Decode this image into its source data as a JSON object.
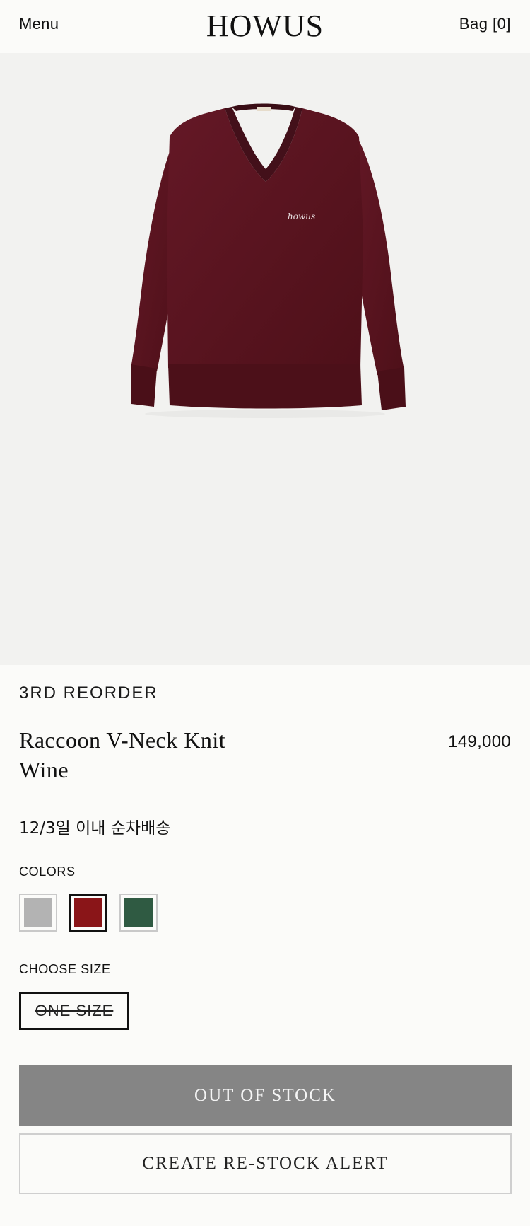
{
  "header": {
    "menu_label": "Menu",
    "logo": "HOWUS",
    "bag_label": "Bag [0]"
  },
  "product": {
    "eyebrow": "3RD REORDER",
    "name_line1": "Raccoon V-Neck Knit",
    "name_line2": "Wine",
    "price": "149,000",
    "shipping_note": "12/3일 이내 순차배송",
    "image_icon": "sweater-product-image",
    "embroidery": "howus"
  },
  "colors": {
    "label": "COLORS",
    "options": [
      {
        "name": "gray",
        "hex": "#b3b3b3",
        "selected": false
      },
      {
        "name": "wine",
        "hex": "#8a1518",
        "selected": true
      },
      {
        "name": "green",
        "hex": "#2f5a42",
        "selected": false
      }
    ]
  },
  "size": {
    "label": "CHOOSE SIZE",
    "option": "ONE SIZE",
    "available": false
  },
  "actions": {
    "out_of_stock": "OUT OF STOCK",
    "restock_alert": "CREATE RE-STOCK ALERT"
  },
  "theme": {
    "background": "#fbfbf9",
    "image_bg": "#f2f2f0",
    "sweater": "#5b1420",
    "disabled_button": "#858585"
  }
}
